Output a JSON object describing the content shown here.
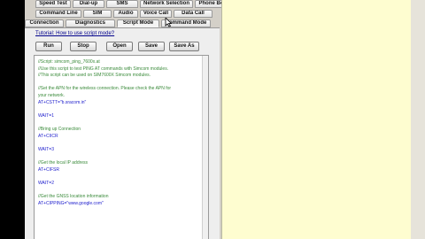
{
  "tabs": {
    "row1": [
      "Speed Test",
      "Dial-up",
      "SMS",
      "Network Selection",
      "Phone Book"
    ],
    "row2": [
      "Command Line",
      "SIM",
      "Audio",
      "Voice Call",
      "Data Call"
    ],
    "row3": [
      "Connection",
      "Diagnostics",
      "Script Mode",
      "Command Mode"
    ],
    "active": "Script Mode"
  },
  "tutorial_link": "Tutorial: How to use script mode?",
  "toolbar": {
    "run": "Run",
    "stop": "Stop",
    "open": "Open",
    "save": "Save",
    "save_as": "Save As"
  },
  "script_lines": [
    {
      "text": "//Script: simcom_ping_7600x.at",
      "type": "comment"
    },
    {
      "text": "//Use this script to test PING AT commands with Simcom modules.",
      "type": "comment"
    },
    {
      "text": "//This script can be used on SIM7600X Simcom modules.",
      "type": "comment"
    },
    {
      "text": "",
      "type": "blank"
    },
    {
      "text": "//Set the APN for the wireless connection. Please check the APN for",
      "type": "comment"
    },
    {
      "text": "your network.",
      "type": "comment"
    },
    {
      "text": "AT+CSTT=\"b.sracom.in\"",
      "type": "cmd"
    },
    {
      "text": "",
      "type": "blank"
    },
    {
      "text": "WAIT=1",
      "type": "cmd"
    },
    {
      "text": "",
      "type": "blank"
    },
    {
      "text": "//Bring up Connection",
      "type": "comment"
    },
    {
      "text": "AT+CIICR",
      "type": "cmd"
    },
    {
      "text": "",
      "type": "blank"
    },
    {
      "text": "WAIT=3",
      "type": "cmd"
    },
    {
      "text": "",
      "type": "blank"
    },
    {
      "text": "//Get the local IP address",
      "type": "comment"
    },
    {
      "text": "AT+CIFSR",
      "type": "cmd"
    },
    {
      "text": "",
      "type": "blank"
    },
    {
      "text": "WAIT=2",
      "type": "cmd"
    },
    {
      "text": "",
      "type": "blank"
    },
    {
      "text": "//Get the GNSS location information",
      "type": "comment"
    },
    {
      "text": "AT+CIPPING=\"www.google.com\"",
      "type": "cmd"
    }
  ],
  "colors": {
    "panel": "#eeeeee",
    "output_bg": "#fefdd0",
    "comment": "#3a8a3a",
    "command": "#1a1acc"
  }
}
